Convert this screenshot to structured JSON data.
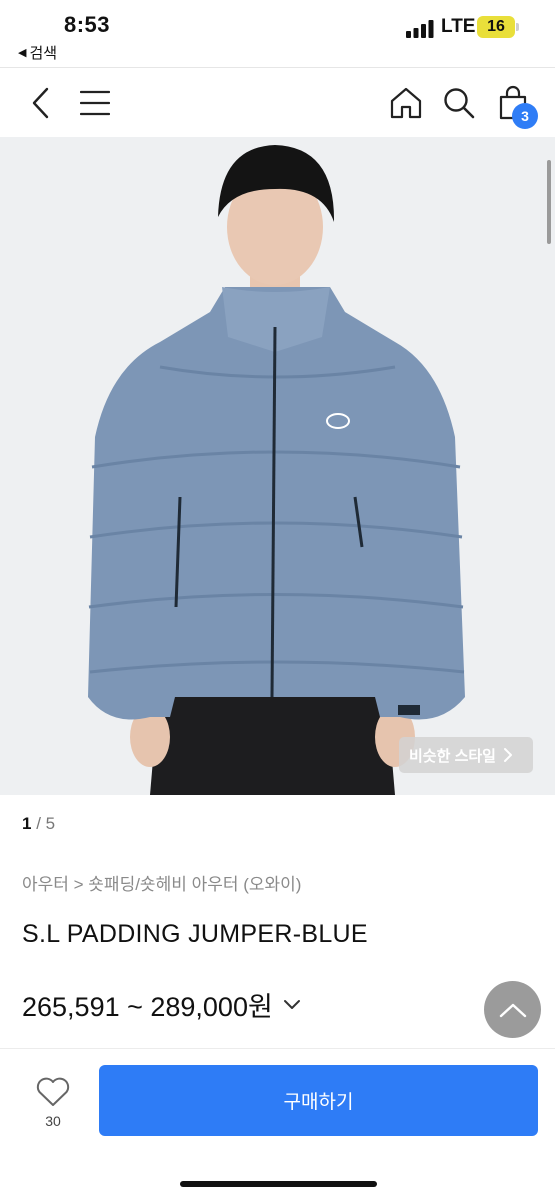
{
  "status_bar": {
    "time": "8:53",
    "back_label": "검색",
    "network": "LTE",
    "battery": "16"
  },
  "nav": {
    "cart_count": "3",
    "icons": [
      "back-chevron-icon",
      "menu-icon",
      "home-icon",
      "search-icon",
      "cart-icon"
    ]
  },
  "gallery": {
    "similar_style_label": "비슷한 스타일",
    "current_page": "1",
    "separator": " / ",
    "total_pages": "5"
  },
  "product": {
    "breadcrumb": "아우터 > 숏패딩/숏헤비 아우터 (오와이)",
    "title": "S.L PADDING JUMPER-BLUE",
    "price_range": "265,591 ~ 289,000원"
  },
  "bottom_bar": {
    "like_count": "30",
    "buy_label": "구매하기"
  },
  "colors": {
    "accent": "#2e7cf6",
    "badge": "#2f7df6",
    "jacket": "#7d96b6",
    "battery": "#e9df3a"
  }
}
